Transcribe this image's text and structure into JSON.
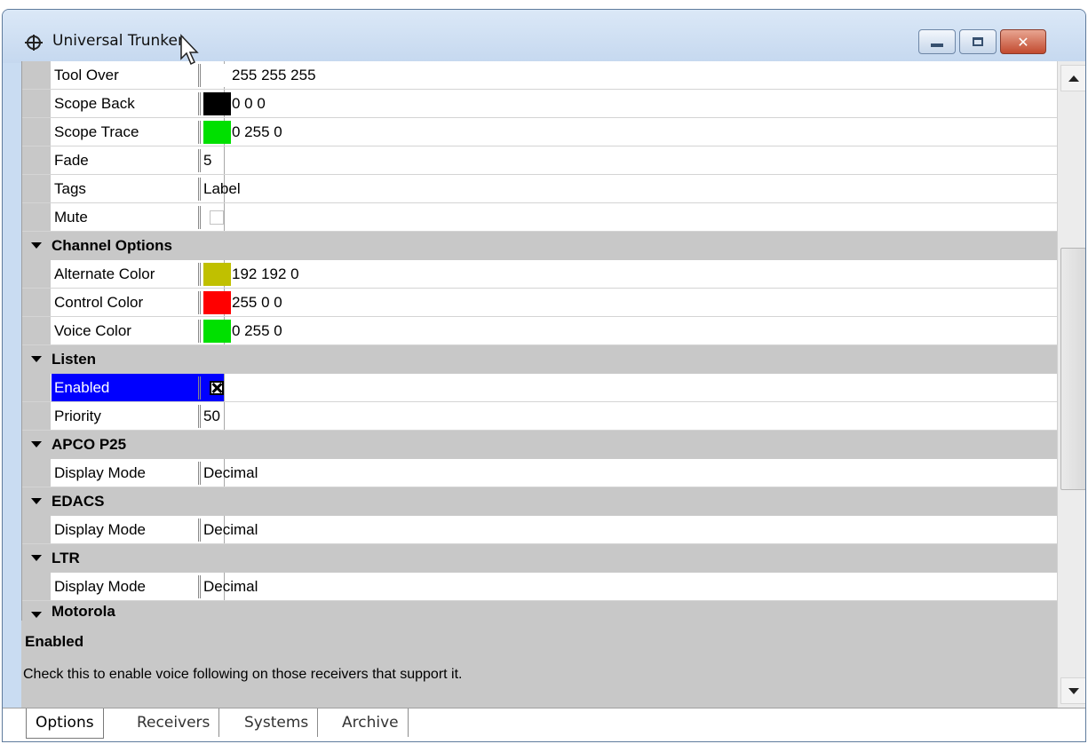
{
  "window": {
    "title": "Universal Trunker"
  },
  "properties": {
    "top_rows": [
      {
        "name": "Tool Over",
        "value": "255 255 255",
        "swatch": "#ffffff"
      },
      {
        "name": "Scope Back",
        "value": "0 0 0",
        "swatch": "#000000"
      },
      {
        "name": "Scope Trace",
        "value": "0 255 0",
        "swatch": "#00e000"
      },
      {
        "name": "Fade",
        "value": "5"
      },
      {
        "name": "Tags",
        "value": "Label"
      },
      {
        "name": "Mute",
        "checked": false
      }
    ],
    "channel_options": {
      "label": "Channel Options",
      "rows": [
        {
          "name": "Alternate Color",
          "value": "192 192 0",
          "swatch": "#c0c000"
        },
        {
          "name": "Control Color",
          "value": "255 0 0",
          "swatch": "#ff0000"
        },
        {
          "name": "Voice Color",
          "value": "0 255 0",
          "swatch": "#00e000"
        }
      ]
    },
    "listen": {
      "label": "Listen",
      "rows": [
        {
          "name": "Enabled",
          "checked": true,
          "selected": true
        },
        {
          "name": "Priority",
          "value": "50"
        }
      ]
    },
    "apco_p25": {
      "label": "APCO P25",
      "rows": [
        {
          "name": "Display Mode",
          "value": "Decimal"
        }
      ]
    },
    "edacs": {
      "label": "EDACS",
      "rows": [
        {
          "name": "Display Mode",
          "value": "Decimal"
        }
      ]
    },
    "ltr": {
      "label": "LTR",
      "rows": [
        {
          "name": "Display Mode",
          "value": "Decimal"
        }
      ]
    },
    "motorola": {
      "label": "Motorola"
    }
  },
  "help": {
    "title": "Enabled",
    "description": "Check this to enable voice following on those receivers that support it."
  },
  "tabs": [
    {
      "label": "Options",
      "active": true
    },
    {
      "label": "Receivers",
      "active": false
    },
    {
      "label": "Systems",
      "active": false
    },
    {
      "label": "Archive",
      "active": false
    }
  ],
  "colors": {
    "selection": "#0000ff",
    "category_bg": "#c8c8c8",
    "title_bg": "#c9dcf2"
  }
}
